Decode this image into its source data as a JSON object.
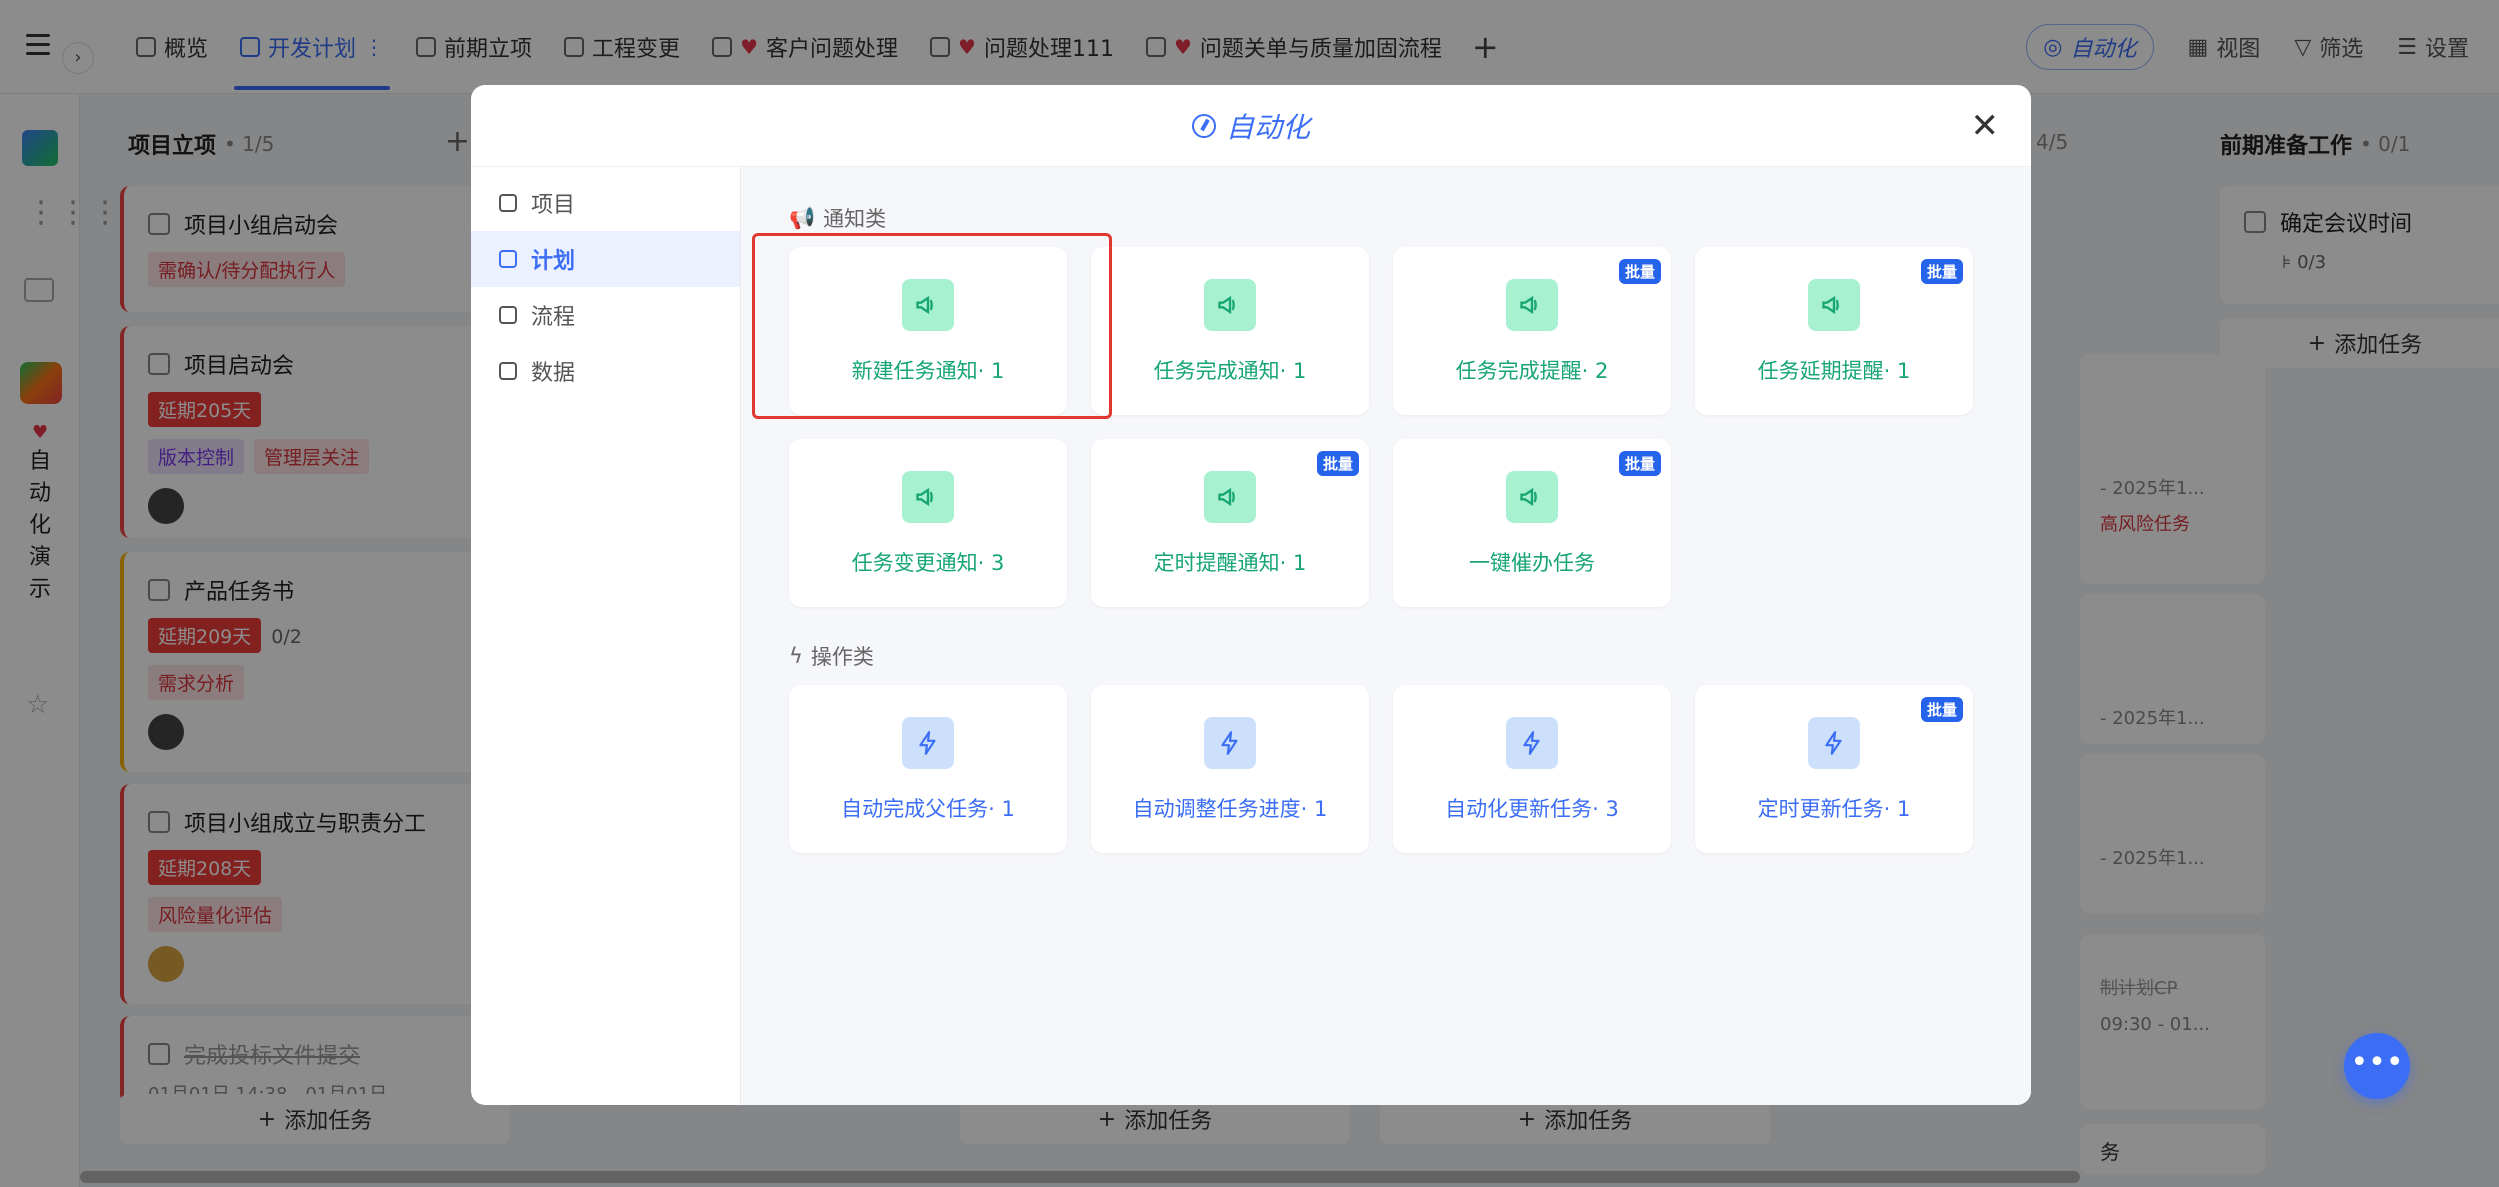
{
  "topbar": {
    "tabs": [
      {
        "label": "概览"
      },
      {
        "label": "开发计划",
        "active": true
      },
      {
        "label": "前期立项"
      },
      {
        "label": "工程变更"
      },
      {
        "label": "客户问题处理"
      },
      {
        "label": "问题处理111"
      },
      {
        "label": "问题关单与质量加固流程"
      }
    ],
    "auto_label": "自动化",
    "view_label": "视图",
    "filter_label": "筛选",
    "settings_label": "设置"
  },
  "leftrail": {
    "project_name": "自动化演示"
  },
  "board": {
    "col1": {
      "title": "项目立项",
      "count": "• 1/5"
    },
    "cards": [
      {
        "title": "项目小组启动会",
        "tags": [
          "需确认/待分配执行人"
        ]
      },
      {
        "title": "项目启动会",
        "overdue": "延期205天",
        "tags": [
          "版本控制",
          "管理层关注"
        ]
      },
      {
        "title": "产品任务书",
        "overdue": "延期209天",
        "sub": "0/2",
        "tags": [
          "需求分析"
        ]
      },
      {
        "title": "项目小组成立与职责分工",
        "overdue": "延期208天",
        "tags": [
          "风险量化评估"
        ]
      },
      {
        "title": "完成投标文件提交",
        "date": "01月01日 14:38 - 01月01日 ..."
      }
    ],
    "add_task": "添加任务",
    "col_right": {
      "title": "前期准备工作",
      "count": "• 0/1",
      "card_title": "确定会议时间",
      "sub": "0/3"
    },
    "mid_count": "4/5",
    "partial_texts": [
      "- 2025年1...",
      "高风险任务",
      "- 2025年1...",
      "- 2025年1...",
      "制计划CP",
      "09:30 - 01...",
      "务"
    ]
  },
  "modal": {
    "title": "自动化",
    "nav": [
      {
        "label": "项目"
      },
      {
        "label": "计划",
        "active": true
      },
      {
        "label": "流程"
      },
      {
        "label": "数据"
      }
    ],
    "sections": {
      "notify": {
        "title": "通知类"
      },
      "action": {
        "title": "操作类"
      }
    },
    "notify_tiles": [
      {
        "label": "新建任务通知· 1",
        "batch": false
      },
      {
        "label": "任务完成通知· 1",
        "batch": false
      },
      {
        "label": "任务完成提醒· 2",
        "batch": true
      },
      {
        "label": "任务延期提醒· 1",
        "batch": true
      },
      {
        "label": "任务变更通知· 3",
        "batch": false
      },
      {
        "label": "定时提醒通知· 1",
        "batch": true
      },
      {
        "label": "一键催办任务",
        "batch": true
      }
    ],
    "action_tiles": [
      {
        "label": "自动完成父任务· 1",
        "batch": false
      },
      {
        "label": "自动调整任务进度· 1",
        "batch": false
      },
      {
        "label": "自动化更新任务· 3",
        "batch": false
      },
      {
        "label": "定时更新任务· 1",
        "batch": true
      }
    ],
    "batch_label": "批量"
  },
  "colors": {
    "accent": "#3b6ef5",
    "notify_green": "#17a673",
    "highlight_red": "#e0372f"
  }
}
